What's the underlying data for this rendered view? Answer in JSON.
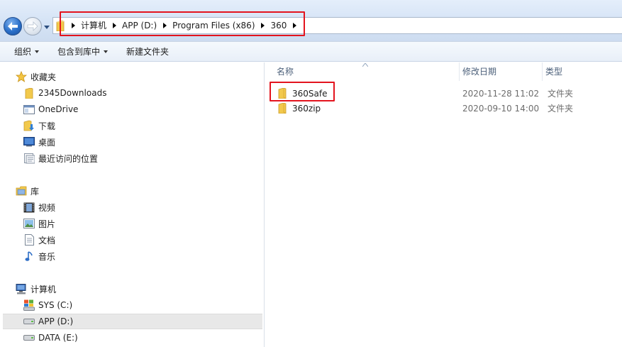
{
  "address": {
    "crumbs": [
      "计算机",
      "APP (D:)",
      "Program Files (x86)",
      "360"
    ]
  },
  "toolbar": {
    "organize_label": "组织",
    "include_label": "包含到库中",
    "new_folder_label": "新建文件夹"
  },
  "nav": {
    "favorites_label": "收藏夹",
    "favorites": [
      "2345Downloads",
      "OneDrive",
      "下载",
      "桌面",
      "最近访问的位置"
    ],
    "libraries_label": "库",
    "libraries": [
      "视频",
      "图片",
      "文档",
      "音乐"
    ],
    "computer_label": "计算机",
    "drives": [
      "SYS (C:)",
      "APP (D:)",
      "DATA (E:)"
    ]
  },
  "columns": {
    "name": "名称",
    "date": "修改日期",
    "type": "类型"
  },
  "files": [
    {
      "name": "360Safe",
      "date": "2020-11-28 11:02",
      "type": "文件夹"
    },
    {
      "name": "360zip",
      "date": "2020-09-10 14:00",
      "type": "文件夹"
    }
  ],
  "colors": {
    "highlight_box": "#e3141e",
    "folder_yellow": "#f2c94c"
  }
}
